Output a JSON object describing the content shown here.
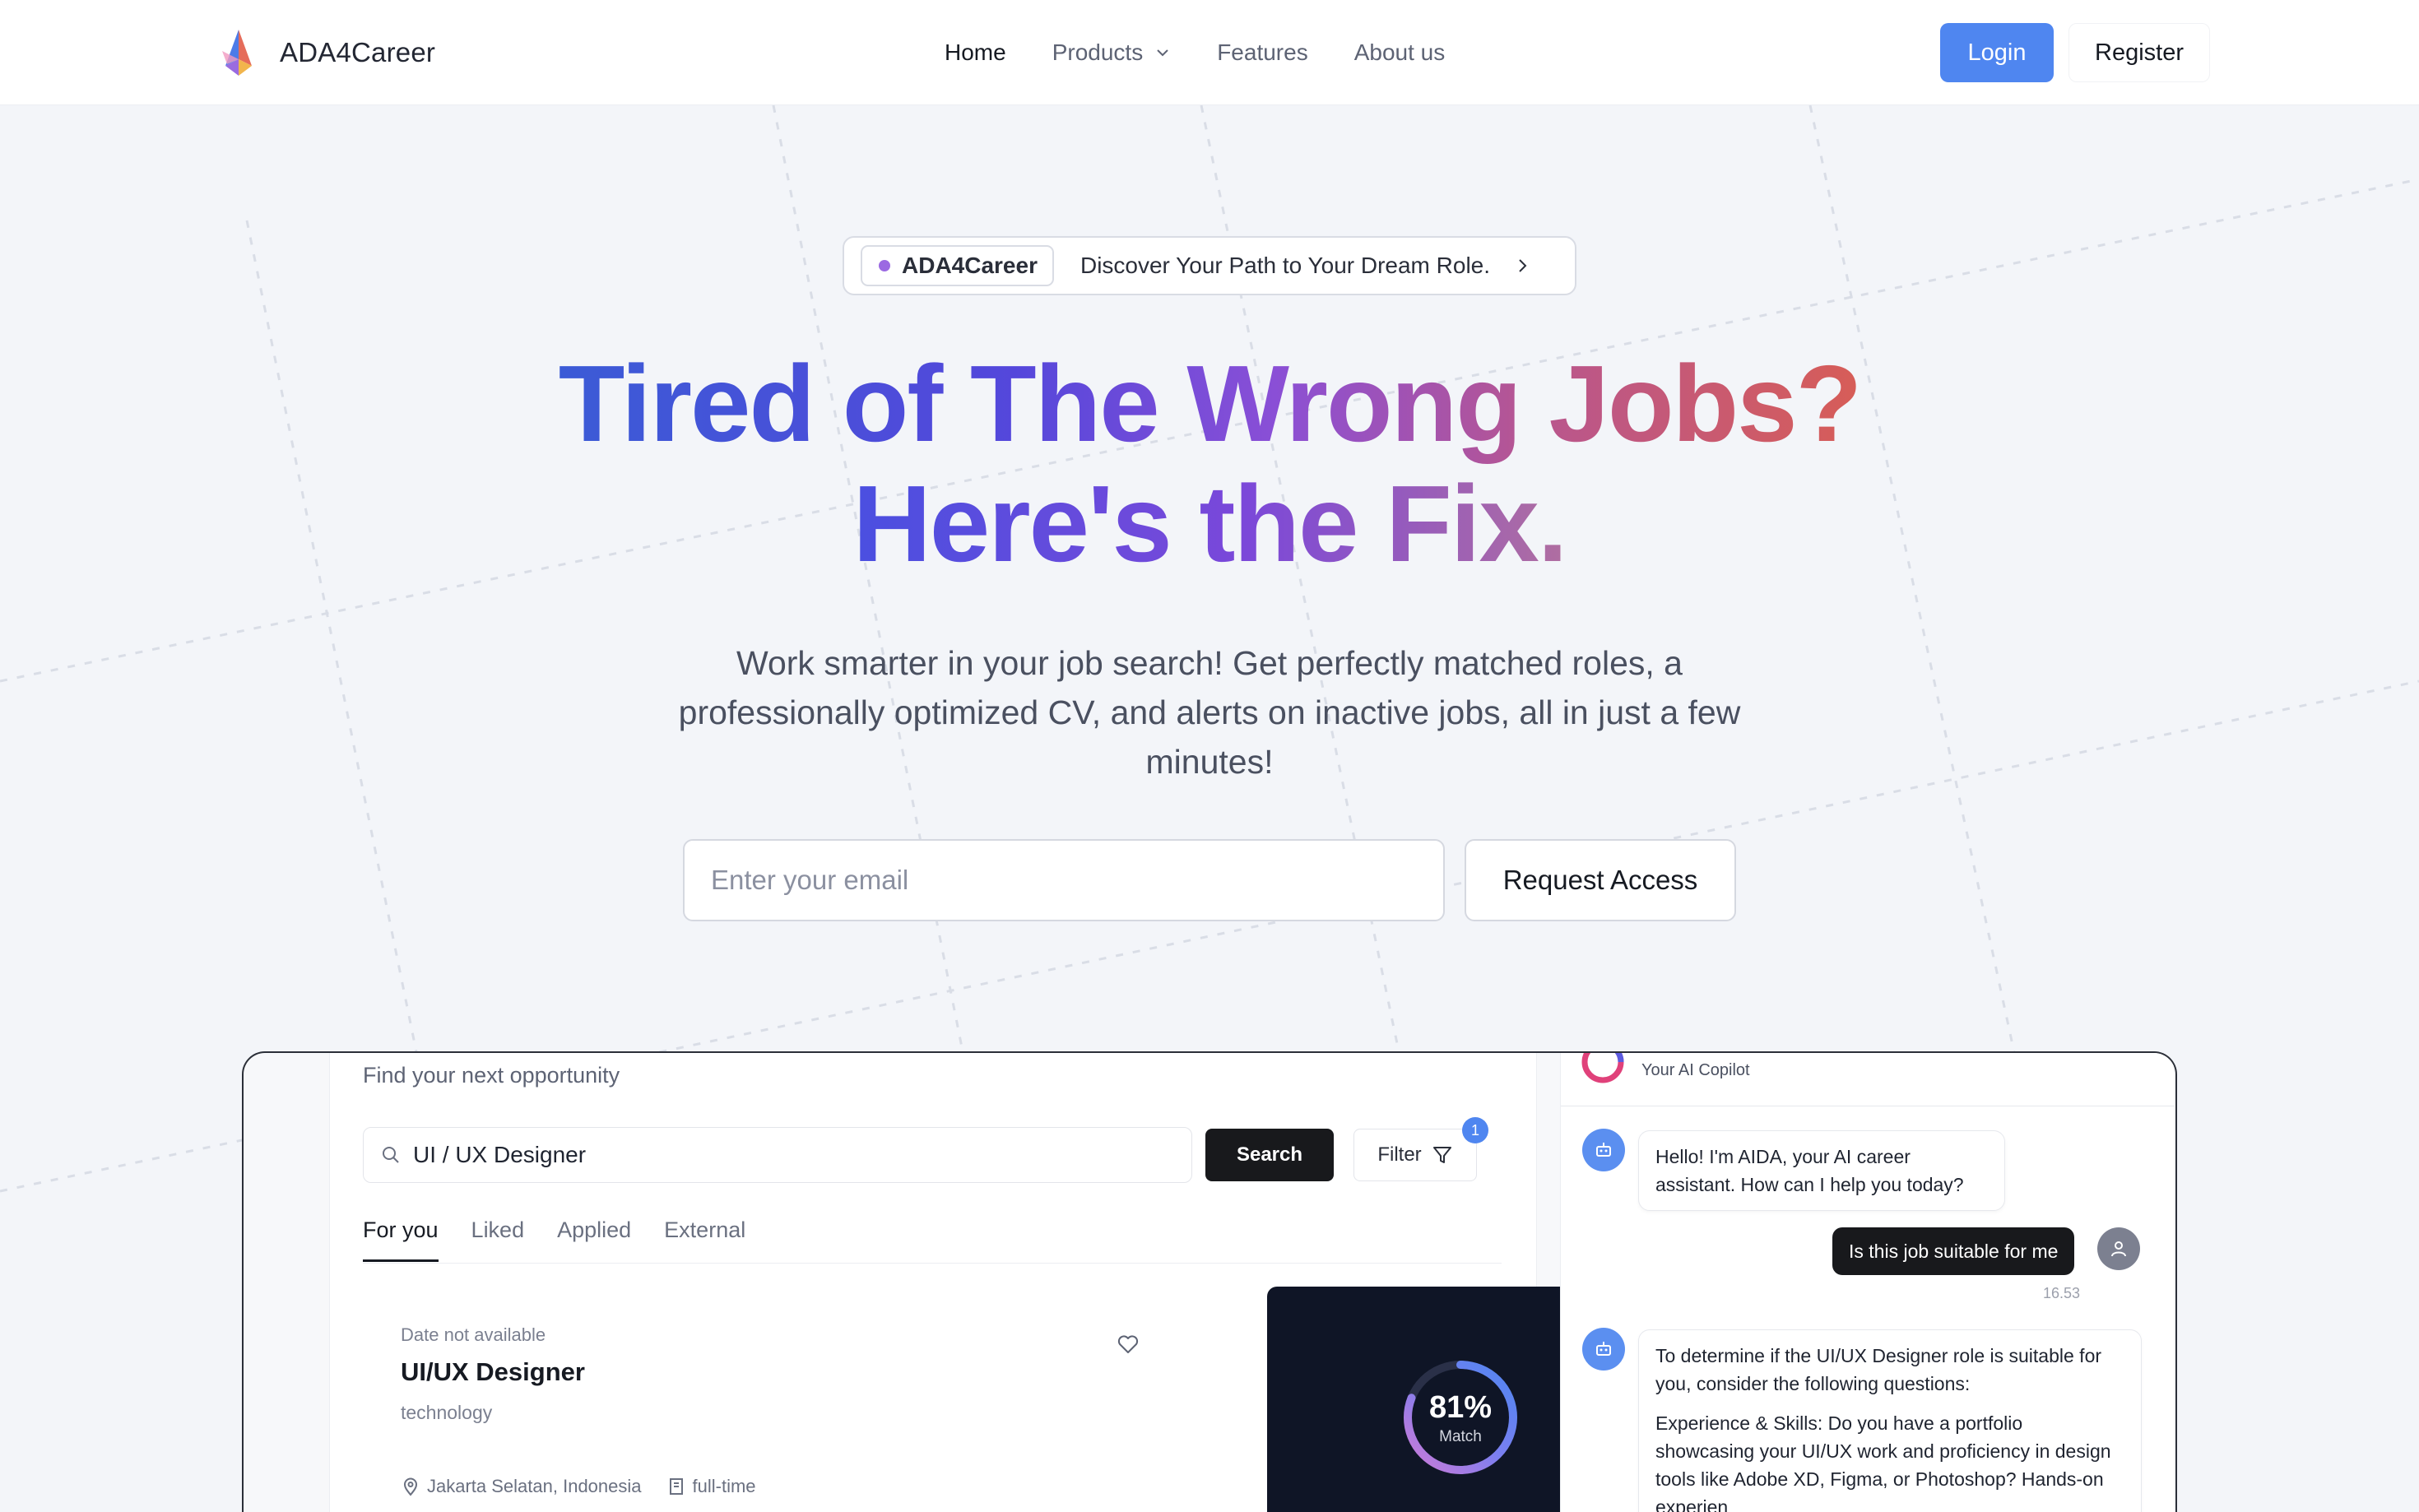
{
  "brand": {
    "name": "ADA4Career"
  },
  "nav": {
    "items": [
      {
        "label": "Home",
        "active": true
      },
      {
        "label": "Products",
        "dropdown": true
      },
      {
        "label": "Features"
      },
      {
        "label": "About us"
      }
    ],
    "login_label": "Login",
    "register_label": "Register"
  },
  "hero": {
    "pill_tag": "ADA4Career",
    "pill_text": "Discover Your Path to Your Dream Role.",
    "headline_line1": "Tired of The Wrong Jobs?",
    "headline_line2": "Here's the Fix.",
    "subtext": "Work smarter in your job search! Get perfectly matched roles, a professionally optimized CV, and alerts on inactive jobs, all in just a few minutes!",
    "email_placeholder": "Enter your email",
    "request_label": "Request Access"
  },
  "preview": {
    "find_title": "Find your next opportunity",
    "search_value": "UI / UX Designer",
    "search_label": "Search",
    "filter_label": "Filter",
    "filter_count": "1",
    "tabs": [
      "For you",
      "Liked",
      "Applied",
      "External"
    ],
    "job": {
      "date": "Date not available",
      "title": "UI/UX Designer",
      "category": "technology",
      "location": "Jakarta Selatan, Indonesia",
      "type": "full-time"
    },
    "match": {
      "percent_label": "81%",
      "value": 0.81,
      "label": "Match"
    },
    "chat": {
      "subtitle": "Your AI Copilot",
      "bot_greeting": "Hello! I'm AIDA, your AI career assistant. How can I help you today?",
      "user_message": "Is this job suitable for me",
      "user_time": "16.53",
      "bot_reply_intro": "To determine if the UI/UX Designer role is suitable for you, consider the following questions:",
      "bot_reply_detail": "Experience & Skills: Do you have a portfolio showcasing your UI/UX work and proficiency in design tools like Adobe XD, Figma, or Photoshop? Hands-on experien"
    }
  },
  "colors": {
    "accent": "#4f86f0",
    "dot": "#9b69e2",
    "headline_start": "#3b5bd6",
    "headline_end": "#d75d57"
  }
}
